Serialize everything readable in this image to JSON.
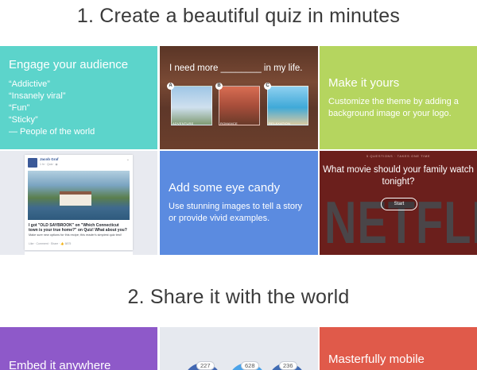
{
  "sections": {
    "create_title": "1. Create a beautiful quiz in minutes",
    "share_title": "2. Share it with the world"
  },
  "engage": {
    "heading": "Engage your audience",
    "quotes": [
      "“Addictive”",
      "“Insanely viral”",
      "“Fun”",
      "“Sticky”",
      "— People of the world"
    ]
  },
  "quiz_example": {
    "question": "I need more ________ in my life.",
    "options": [
      {
        "badge": "A",
        "label": "ADVENTURE"
      },
      {
        "badge": "B",
        "label": "ROMANCE"
      },
      {
        "badge": "C",
        "label": "RELAXATION"
      }
    ]
  },
  "make_it_yours": {
    "heading": "Make it yours",
    "description": "Customize the theme by adding a background image or your logo."
  },
  "facebook_post": {
    "name": "Jacob Graf",
    "time": "1 hr · Quiz · ◉",
    "menu": "⌄",
    "headline": "I got \"OLD SAYBROOK\" on \"Which Connecticut town is your true home?\" on Quiz! What about you?",
    "subline": "Make sure new options for this recipe; this reader's simplest quiz test!",
    "footer": "Like · Comment · Share · 👍 6875"
  },
  "eye_candy": {
    "heading": "Add some eye candy",
    "description": "Use stunning images to tell a story or provide vivid examples."
  },
  "netflix_quiz": {
    "meta": "5 QUESTIONS · TAKES ONE TIME",
    "question": "What movie should your family watch tonight?",
    "start_label": "Start",
    "brand_text": "NETFLIX"
  },
  "embed": {
    "heading": "Embed it anywhere"
  },
  "share_counts": [
    "227",
    "628",
    "236"
  ],
  "mobile": {
    "heading": "Masterfully mobile"
  },
  "colors": {
    "teal": "#5cd4cb",
    "green": "#b5d55f",
    "blue": "#5b8be0",
    "netflix_red": "#6b1f1c",
    "purple": "#8e59c9",
    "coral": "#e05a4a"
  }
}
